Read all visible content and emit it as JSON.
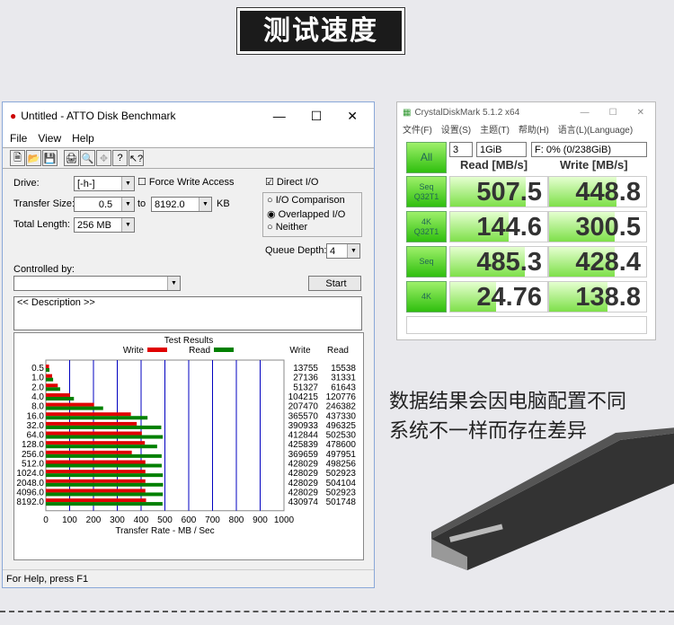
{
  "banner": {
    "title": "测试速度"
  },
  "atto": {
    "window_title": "Untitled - ATTO Disk Benchmark",
    "menu": [
      "File",
      "View",
      "Help"
    ],
    "drive_label": "Drive:",
    "drive_value": "[-h-]",
    "force_write": "Force Write Access",
    "direct_io": "Direct I/O",
    "transfer_label": "Transfer Size:",
    "transfer_from": "0.5",
    "to": "to",
    "transfer_to": "8192.0",
    "kb": "KB",
    "total_label": "Total Length:",
    "total_value": "256 MB",
    "radios": [
      "I/O Comparison",
      "Overlapped I/O",
      "Neither"
    ],
    "queue_label": "Queue Depth:",
    "queue_value": "4",
    "controlled_by": "Controlled by:",
    "start": "Start",
    "description": "<< Description >>",
    "status": "For Help, press F1"
  },
  "chart_data": {
    "type": "bar",
    "title": "Test Results",
    "xlabel": "Transfer Rate - MB / Sec",
    "xlim": [
      0,
      1000
    ],
    "xticks": [
      "0",
      "100",
      "200",
      "300",
      "400",
      "500",
      "600",
      "700",
      "800",
      "900",
      "1000"
    ],
    "legend": [
      "Write",
      "Read"
    ],
    "col_headers": [
      "Write",
      "Read"
    ],
    "categories": [
      "0.5",
      "1.0",
      "2.0",
      "4.0",
      "8.0",
      "16.0",
      "32.0",
      "64.0",
      "128.0",
      "256.0",
      "512.0",
      "1024.0",
      "2048.0",
      "4096.0",
      "8192.0"
    ],
    "series": [
      {
        "name": "Write",
        "color": "#e00000",
        "values": [
          13755,
          27136,
          51327,
          104215,
          207470,
          365570,
          390933,
          412844,
          425839,
          369659,
          428029,
          428029,
          428029,
          428029,
          430974
        ]
      },
      {
        "name": "Read",
        "color": "#008000",
        "values": [
          15538,
          31331,
          61643,
          120776,
          246382,
          437330,
          496325,
          502530,
          478600,
          497951,
          498256,
          502923,
          504104,
          502923,
          501748
        ]
      }
    ]
  },
  "cdm": {
    "title": "CrystalDiskMark 5.1.2 x64",
    "menu": [
      "文件(F)",
      "设置(S)",
      "主题(T)",
      "帮助(H)",
      "语言(L)(Language)"
    ],
    "all": "All",
    "count": "3",
    "size": "1GiB",
    "drive": "F: 0% (0/238GiB)",
    "read_header": "Read [MB/s]",
    "write_header": "Write [MB/s]",
    "rows": [
      {
        "label": "Seq\nQ32T1",
        "read": "507.5",
        "write": "448.8",
        "read_pct": 0.78,
        "write_pct": 0.69
      },
      {
        "label": "4K\nQ32T1",
        "read": "144.6",
        "write": "300.5",
        "read_pct": 0.6,
        "write_pct": 0.68
      },
      {
        "label": "Seq",
        "read": "485.3",
        "write": "428.4",
        "read_pct": 0.77,
        "write_pct": 0.68
      },
      {
        "label": "4K",
        "read": "24.76",
        "write": "138.8",
        "read_pct": 0.47,
        "write_pct": 0.6
      }
    ]
  },
  "note": {
    "line1": "数据结果会因电脑配置不同",
    "line2": "系统不一样而存在差异"
  }
}
